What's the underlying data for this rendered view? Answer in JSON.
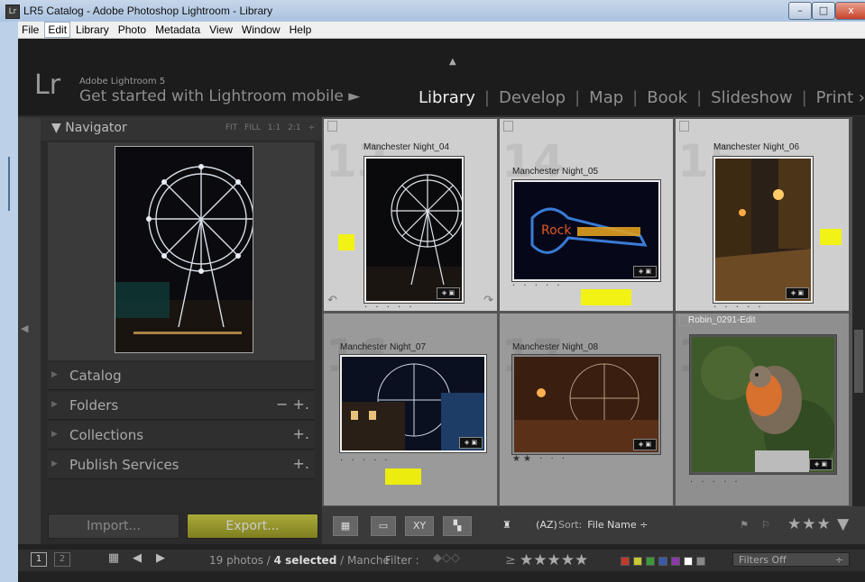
{
  "window": {
    "title": "LR5 Catalog - Adobe Photoshop Lightroom - Library",
    "app_icon": "Lr",
    "min": "–",
    "max": "□",
    "close": "x"
  },
  "menubar": {
    "items": [
      "File",
      "Edit",
      "Library",
      "Photo",
      "Metadata",
      "View",
      "Window",
      "Help"
    ],
    "active": "Edit"
  },
  "identity": {
    "logo": "Lr",
    "product": "Adobe Lightroom 5",
    "mobile": "Get started with Lightroom mobile ►"
  },
  "modules": {
    "items": [
      "Library",
      "Develop",
      "Map",
      "Book",
      "Slideshow",
      "Print ›"
    ],
    "active": "Library"
  },
  "navigator": {
    "title": "▼  Navigator",
    "options": "FIT FILL 1:1 2:1 ÷"
  },
  "panels": [
    {
      "label": "Catalog",
      "control": ""
    },
    {
      "label": "Folders",
      "control": "− +."
    },
    {
      "label": "Collections",
      "control": "+."
    },
    {
      "label": "Publish Services",
      "control": "+."
    }
  ],
  "buttons": {
    "import": "Import...",
    "export": "Export..."
  },
  "grid": {
    "cells": [
      {
        "index": "13",
        "name": "Manchester Night_04",
        "selected": false,
        "dots": "· · · · ·"
      },
      {
        "index": "14",
        "name": "Manchester Night_05",
        "selected": false,
        "dots": "· · · · ·"
      },
      {
        "index": "15",
        "name": "Manchester Night_06",
        "selected": false,
        "dots": "· · · · ·"
      },
      {
        "index": "16",
        "name": "Manchester Night_07",
        "selected": false,
        "dots": "· · · · ·"
      },
      {
        "index": "17",
        "name": "Manchester Night_08",
        "selected": false,
        "dots": "★★ · · ·"
      },
      {
        "index": "18",
        "name": "Robin_0291-Edit",
        "selected": true,
        "dots": "· · · · ·"
      }
    ],
    "highlight_color": "#f5f500"
  },
  "toolbar": {
    "view_compare": "XY",
    "sort_label": "Sort:",
    "sort_value": "File Name ÷",
    "stars": "★★★ ▼",
    "sort_icon": "(AZ)"
  },
  "filmstrip": {
    "monitor1": "1",
    "monitor2": "2",
    "count_prefix": "19 photos /",
    "count_selected": "4 selected",
    "count_suffix": "/ Manche",
    "filter_label": "Filter :",
    "ge": "≥",
    "filter_stars": "★★★★★",
    "filters_off": "Filters Off",
    "swatches": [
      "#c0392b",
      "#c8c830",
      "#3a9a3a",
      "#3a5aa8",
      "#8a3aa8",
      "#ffffff",
      "#888888"
    ]
  },
  "accent_export": "#9b9b2a"
}
